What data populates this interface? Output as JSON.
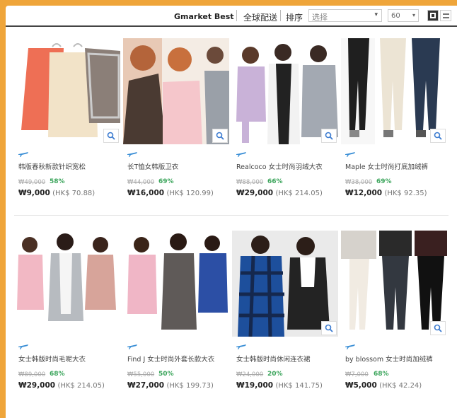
{
  "toolbar": {
    "brand": "Gmarket Best",
    "global_label": "全球配送",
    "sort_label": "排序",
    "sort_value": "选择",
    "per_page_value": "60"
  },
  "accent_colors": {
    "frame": "#efa53a",
    "discount": "#3ca55c"
  },
  "products": [
    {
      "title": "韩版春秋新款针织宽松",
      "old_price": "₩49,000",
      "discount": "58%",
      "price": "₩9,000",
      "hk_price": "(HK$ 70.88)"
    },
    {
      "title": "长T恤女韩版卫衣",
      "old_price": "₩44,000",
      "discount": "69%",
      "price": "₩16,000",
      "hk_price": "(HK$ 120.99)"
    },
    {
      "title": "Realcoco 女士时尚羽绒大衣",
      "old_price": "₩88,000",
      "discount": "66%",
      "price": "₩29,000",
      "hk_price": "(HK$ 214.05)"
    },
    {
      "title": "Maple 女士时尚打底加绒裤",
      "old_price": "₩38,000",
      "discount": "69%",
      "price": "₩12,000",
      "hk_price": "(HK$ 92.35)"
    },
    {
      "title": "女士韩版时尚毛呢大衣",
      "old_price": "₩89,000",
      "discount": "68%",
      "price": "₩29,000",
      "hk_price": "(HK$ 214.05)"
    },
    {
      "title": "Find J 女士时尚外套长款大衣",
      "old_price": "₩55,000",
      "discount": "50%",
      "price": "₩27,000",
      "hk_price": "(HK$ 199.73)"
    },
    {
      "title": "女士韩版时尚休闲连衣裙",
      "old_price": "₩24,000",
      "discount": "20%",
      "price": "₩19,000",
      "hk_price": "(HK$ 141.75)"
    },
    {
      "title": "by blossom 女士时尚加绒裤",
      "old_price": "₩7,000",
      "discount": "68%",
      "price": "₩5,000",
      "hk_price": "(HK$ 42.24)"
    }
  ]
}
